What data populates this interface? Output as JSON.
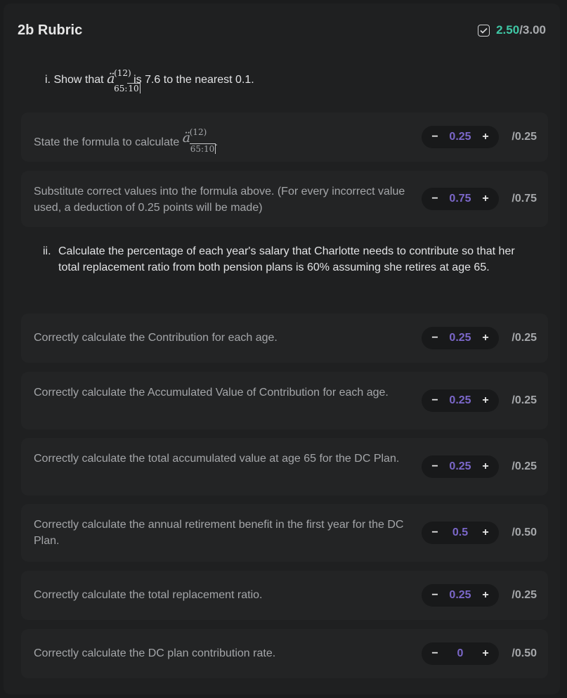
{
  "header": {
    "title": "2b Rubric",
    "score_earned": "2.50",
    "score_total": "/3.00"
  },
  "q1": {
    "num": "i.",
    "text_before": "Show that",
    "math_sup": "(12)",
    "math_sub_a": "65",
    "math_sub_b": "10",
    "math_sub_sep": ":",
    "text_after": "is 7.6 to the nearest 0.1."
  },
  "q2": {
    "num": "ii.",
    "text": "Calculate the percentage of each year's salary that Charlotte needs to contribute so that her total replacement ratio from both pension plans is 60% assuming she retires at age 65."
  },
  "items": [
    {
      "label": "State the formula to calculate",
      "math_sup": "(12)",
      "math_sub": "65:10",
      "label_tail": ".",
      "value": "0.25",
      "max": "/0.25"
    },
    {
      "label": "Substitute correct values into the formula above. (For every incorrect value used, a deduction of 0.25 points will be made)",
      "value": "0.75",
      "max": "/0.75"
    },
    {
      "label": "Correctly calculate the Contribution for each age.",
      "value": "0.25",
      "max": "/0.25"
    },
    {
      "label": "Correctly calculate the Accumulated Value of Contribution for each age.",
      "value": "0.25",
      "max": "/0.25"
    },
    {
      "label": "Correctly calculate the total accumulated value at age 65 for the DC Plan.",
      "value": "0.25",
      "max": "/0.25"
    },
    {
      "label": "Correctly calculate the annual retirement benefit in the first year for the DC Plan.",
      "value": "0.5",
      "max": "/0.50"
    },
    {
      "label": "Correctly calculate the total replacement ratio.",
      "value": "0.25",
      "max": "/0.25"
    },
    {
      "label": "Correctly calculate the DC plan contribution rate.",
      "value": "0",
      "max": "/0.50"
    }
  ],
  "controls": {
    "minus": "−",
    "plus": "+"
  },
  "accent_colors": {
    "score_earned": "#3fc7a5",
    "stepper_value": "#7b67c9"
  },
  "icons": {
    "header_check": "checkbox-checked-icon"
  }
}
